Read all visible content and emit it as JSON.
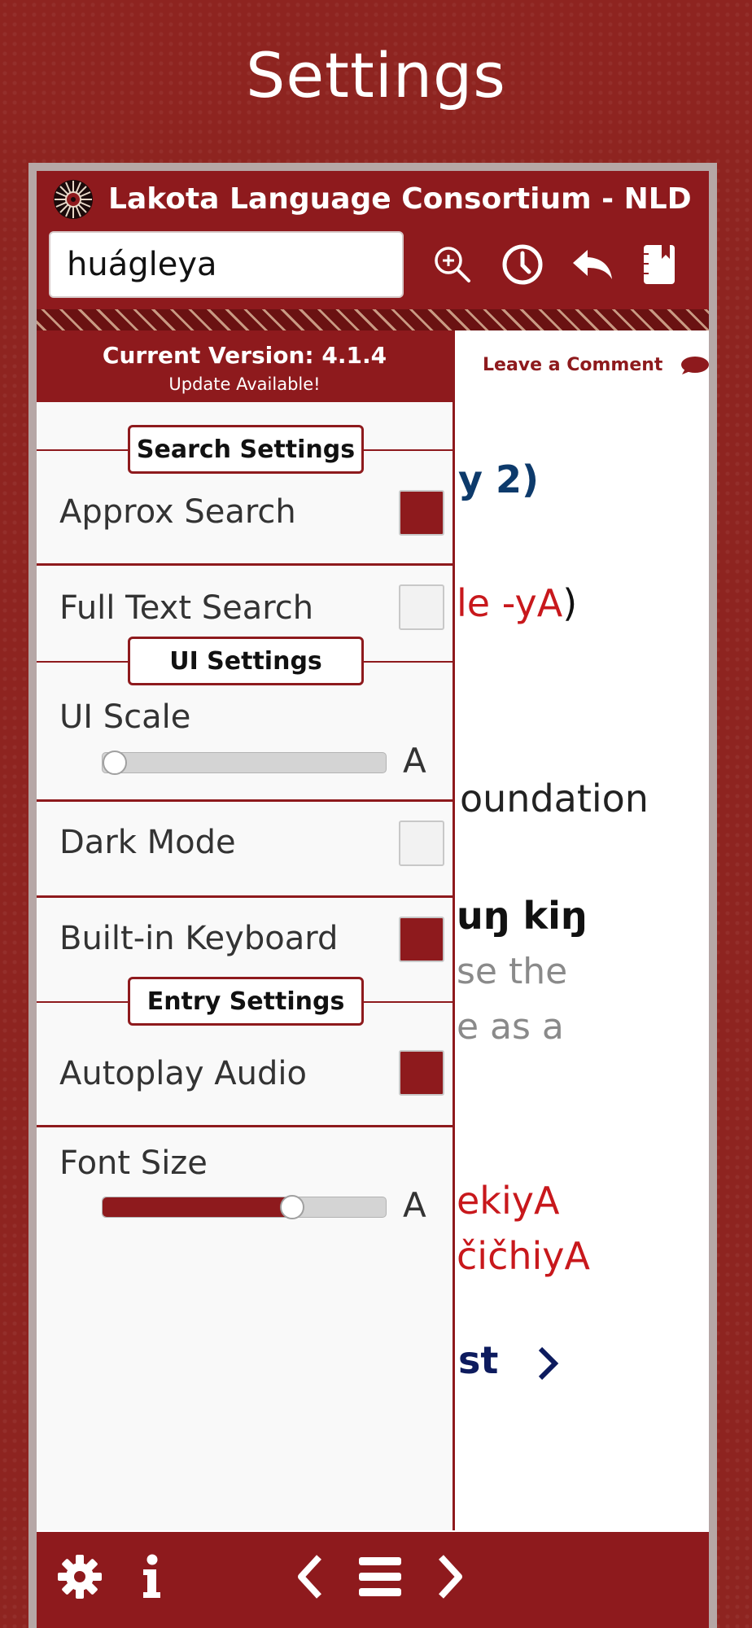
{
  "page": {
    "title": "Settings"
  },
  "header": {
    "app_title": "Lakota Language Consortium - NLD",
    "search_value": "huágleya",
    "icons": [
      "zoom-in-icon",
      "history-clock-icon",
      "back-reply-icon",
      "bookmark-book-icon"
    ]
  },
  "content": {
    "leave_comment": "Leave a Comment",
    "line1": "y 2)",
    "line2_red": "le -yA",
    "line2_paren": ")",
    "line3": "oundation",
    "line4": "uŋ kiŋ",
    "line5": "se the",
    "line6": "e as a",
    "line7": "ekiyA",
    "line8": "čičhiyA",
    "line9": "st"
  },
  "drawer": {
    "version": "Current Version: 4.1.4",
    "update": "Update Available!",
    "sections": {
      "search": "Search Settings",
      "ui": "UI Settings",
      "entry": "Entry Settings"
    },
    "approx_search": {
      "label": "Approx Search",
      "checked": true
    },
    "full_text_search": {
      "label": "Full Text Search",
      "checked": false
    },
    "ui_scale": {
      "label": "UI Scale",
      "value": 0.0,
      "glyph": "A"
    },
    "dark_mode": {
      "label": "Dark Mode",
      "checked": false
    },
    "builtin_keyboard": {
      "label": "Built-in Keyboard",
      "checked": true
    },
    "autoplay_audio": {
      "label": "Autoplay Audio",
      "checked": true
    },
    "font_size": {
      "label": "Font Size",
      "value": 0.67,
      "glyph": "A"
    }
  },
  "bottom_bar": {
    "icons": [
      "gear-icon",
      "info-icon",
      "chevron-left-icon",
      "menu-icon",
      "chevron-right-icon"
    ]
  },
  "colors": {
    "brand": "#8e1a1d",
    "link_blue": "#0d3a6b",
    "content_red": "#c8181c"
  }
}
